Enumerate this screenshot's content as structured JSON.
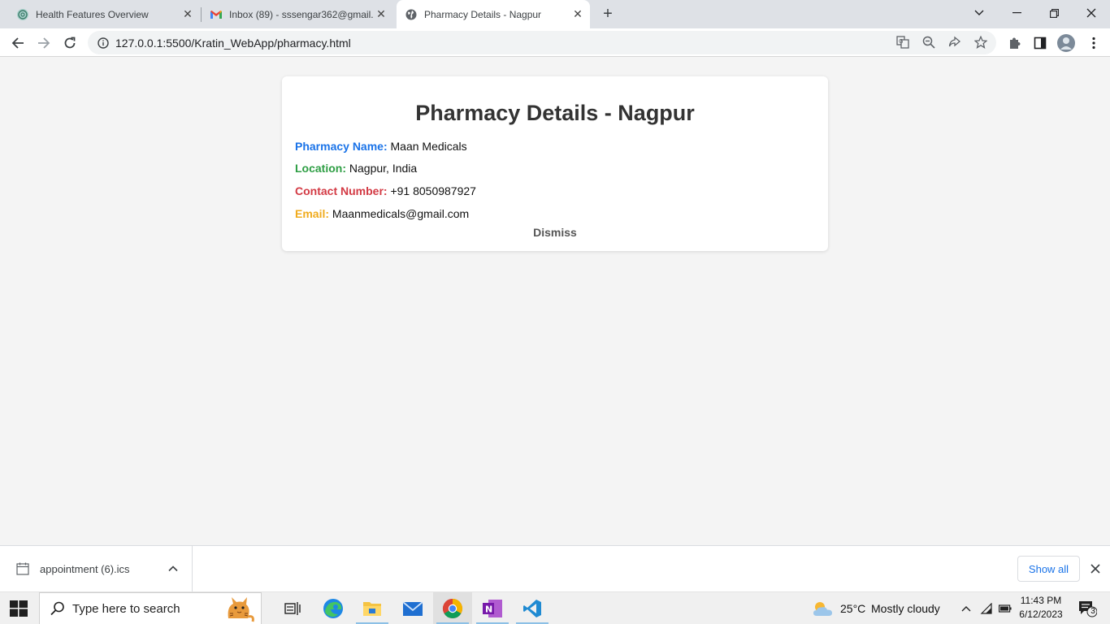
{
  "browser": {
    "tabs": [
      {
        "title": "Health Features Overview",
        "icon": "chatgpt-icon",
        "active": false
      },
      {
        "title": "Inbox (89) - sssengar362@gmail.",
        "icon": "gmail-icon",
        "active": false
      },
      {
        "title": "Pharmacy Details - Nagpur",
        "icon": "globe-icon",
        "active": true
      }
    ],
    "address": "127.0.0.1:5500/Kratin_WebApp/pharmacy.html"
  },
  "page": {
    "heading": "Pharmacy Details - Nagpur",
    "fields": [
      {
        "label": "Pharmacy Name:",
        "value": "Maan Medicals",
        "color": "#1a73e8"
      },
      {
        "label": "Location:",
        "value": "Nagpur, India",
        "color": "#2e9e44"
      },
      {
        "label": "Contact Number:",
        "value": "+91 8050987927",
        "color": "#d33a44"
      },
      {
        "label": "Email:",
        "value": "Maanmedicals@gmail.com",
        "color": "#f0ab1d"
      }
    ],
    "dismiss_label": "Dismiss"
  },
  "downloads": {
    "file_name": "appointment (6).ics",
    "show_all_label": "Show all"
  },
  "taskbar": {
    "search_placeholder": "Type here to search",
    "weather_temp": "25°C",
    "weather_desc": "Mostly cloudy",
    "time": "11:43 PM",
    "date": "6/12/2023",
    "notification_count": "3"
  }
}
